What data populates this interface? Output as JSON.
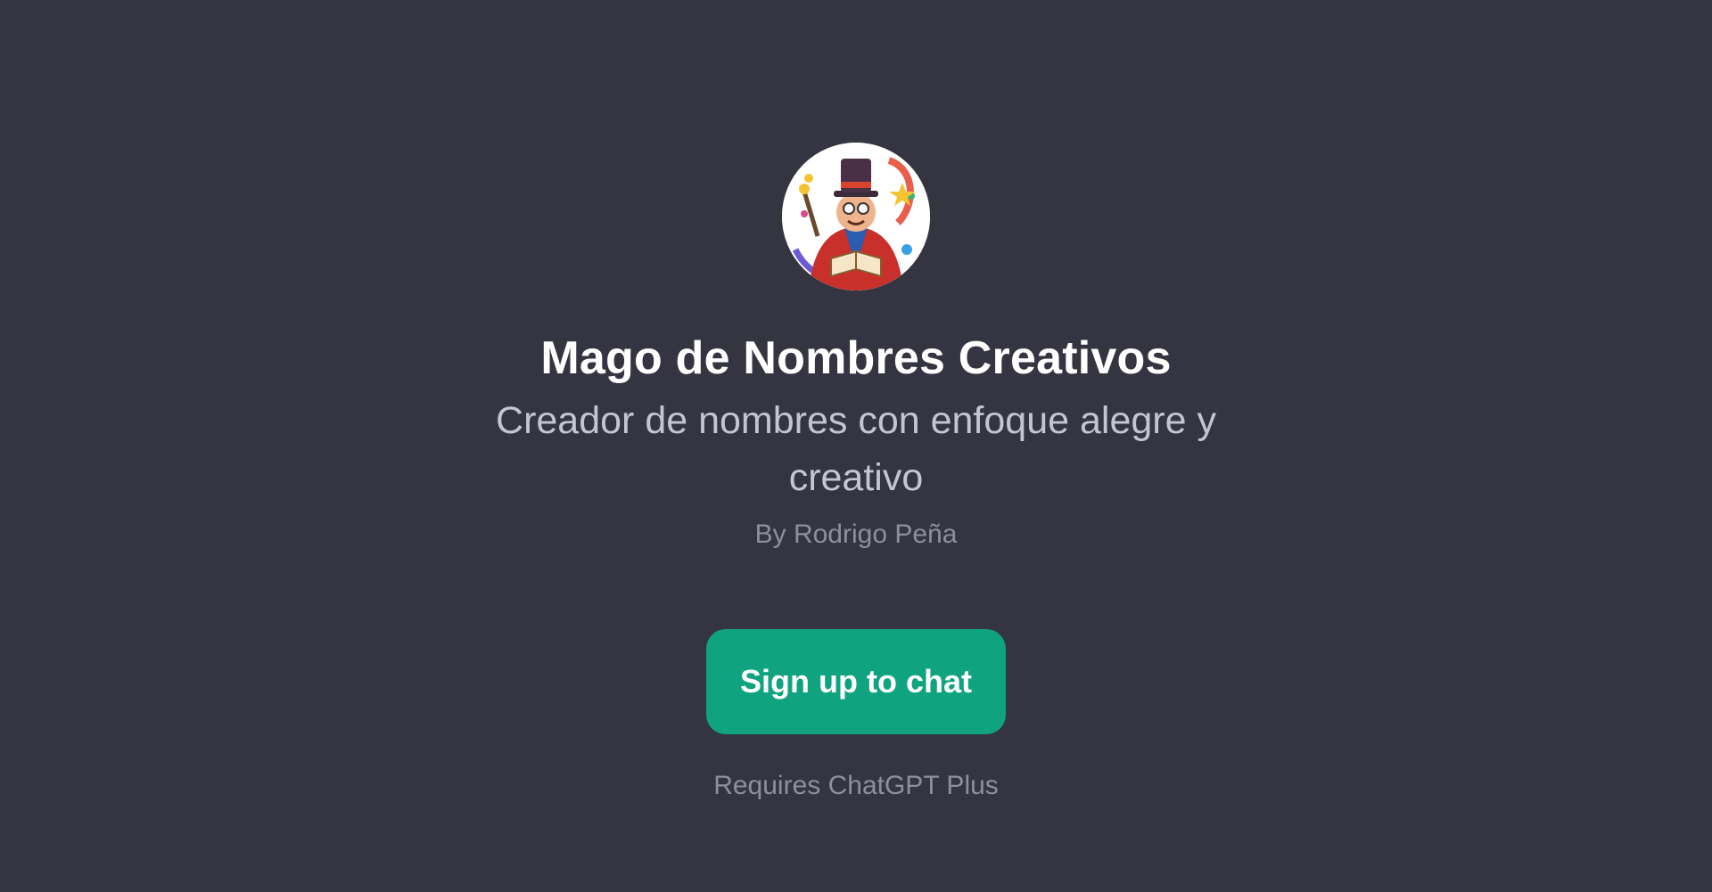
{
  "gpt": {
    "name": "Mago de Nombres Creativos",
    "description": "Creador de nombres con enfoque alegre y creativo",
    "author": "By Rodrigo Peña",
    "avatar_icon": "wizard-avatar-icon"
  },
  "actions": {
    "signup_label": "Sign up to chat"
  },
  "footer": {
    "requires_text": "Requires ChatGPT Plus"
  },
  "colors": {
    "background": "#343541",
    "button": "#10a37f",
    "title": "#ffffff",
    "subtitle": "#c5c5d2",
    "muted": "#8e8ea0"
  }
}
